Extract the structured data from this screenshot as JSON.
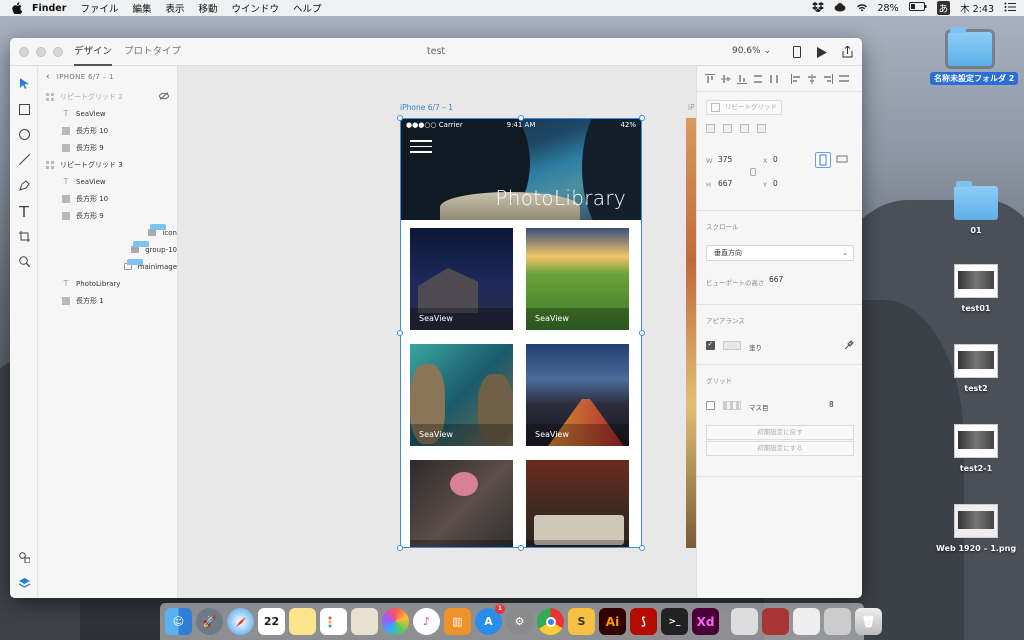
{
  "menubar": {
    "app": "Finder",
    "items": [
      "ファイル",
      "編集",
      "表示",
      "移動",
      "ウインドウ",
      "ヘルプ"
    ],
    "battery": "28%",
    "input": "あ",
    "clock": "木 2:43"
  },
  "window": {
    "tabs": [
      "デザイン",
      "プロトタイプ"
    ],
    "title": "test",
    "zoom": "90.6%"
  },
  "layers": {
    "header": "IPHONE 6/7 – 1",
    "items": [
      {
        "label": "リピートグリッド 2",
        "icon": "grid",
        "indent": 0,
        "dim": true
      },
      {
        "label": "SeaView",
        "icon": "text",
        "indent": 1
      },
      {
        "label": "長方形 10",
        "icon": "rect",
        "indent": 1
      },
      {
        "label": "長方形 9",
        "icon": "rect",
        "indent": 1
      },
      {
        "label": "リピートグリッド 3",
        "icon": "grid",
        "indent": 0
      },
      {
        "label": "SeaView",
        "icon": "text",
        "indent": 1
      },
      {
        "label": "長方形 10",
        "icon": "rect",
        "indent": 1
      },
      {
        "label": "長方形 9",
        "icon": "rect",
        "indent": 1
      },
      {
        "label": "icon",
        "icon": "folder",
        "indent": 0
      },
      {
        "label": "group-10",
        "icon": "folder",
        "indent": 0
      },
      {
        "label": "mainimage",
        "icon": "folder-open",
        "indent": 0
      },
      {
        "label": "PhotoLibrary",
        "icon": "text",
        "indent": 1
      },
      {
        "label": "長方形 1",
        "icon": "rect",
        "indent": 1
      }
    ]
  },
  "artboard": {
    "label": "iPhone 6/7 – 1",
    "label2": "iP",
    "status": {
      "carrier": "●●●○○ Carrier",
      "time": "9:41 AM",
      "battery": "42%"
    },
    "hero_title": "PhotoLibrary",
    "cards": [
      {
        "caption": "SeaView"
      },
      {
        "caption": "SeaView"
      },
      {
        "caption": "SeaView"
      },
      {
        "caption": "SeaView"
      },
      {
        "caption": ""
      },
      {
        "caption": ""
      }
    ]
  },
  "inspector": {
    "repeat_grid_btn": "リピートグリッド",
    "w_label": "W",
    "w": "375",
    "x_label": "X",
    "x": "0",
    "h_label": "H",
    "h": "667",
    "y_label": "Y",
    "y": "0",
    "scroll_title": "スクロール",
    "scroll_value": "垂直方向",
    "viewport_label": "ビューポートの高さ",
    "viewport_value": "667",
    "appearance_title": "アピアランス",
    "fill_label": "塗り",
    "grid_title": "グリッド",
    "grid_label": "マス目",
    "grid_value": "8",
    "reset_btn": "初期設定に戻す",
    "default_btn": "初期設定にする"
  },
  "desktop": {
    "icons": [
      {
        "label": "名称未設定フォルダ 2",
        "type": "folder",
        "selected": true
      },
      {
        "label": "01",
        "type": "folder"
      },
      {
        "label": "test01",
        "type": "image"
      },
      {
        "label": "test2",
        "type": "image"
      },
      {
        "label": "test2-1",
        "type": "image"
      },
      {
        "label": "Web 1920 – 1.png",
        "type": "image"
      }
    ]
  },
  "dock": {
    "calendar_day": "22",
    "appstore_badge": "1",
    "ai_label": "Ai",
    "xd_label": "Xd"
  },
  "colors": {
    "accent": "#3a8ee6",
    "xd": "#470137",
    "illustrator": "#330000"
  }
}
